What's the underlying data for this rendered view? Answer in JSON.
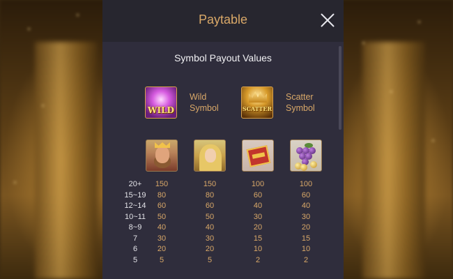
{
  "header": {
    "title": "Paytable"
  },
  "section_title": "Symbol Payout Values",
  "special_symbols": [
    {
      "icon": "wild-symbol-icon",
      "badge": "WILD",
      "name": "Wild Symbol"
    },
    {
      "icon": "scatter-symbol-icon",
      "badge": "SCATTER",
      "name": "Scatter Symbol"
    }
  ],
  "pay_symbols": [
    {
      "icon": "king-symbol-icon"
    },
    {
      "icon": "queen-symbol-icon"
    },
    {
      "icon": "treasure-chest-symbol-icon"
    },
    {
      "icon": "grapes-symbol-icon"
    }
  ],
  "paytable": {
    "rows": [
      {
        "count": "20+",
        "values": [
          "150",
          "150",
          "100",
          "100"
        ]
      },
      {
        "count": "15~19",
        "values": [
          "80",
          "80",
          "60",
          "60"
        ]
      },
      {
        "count": "12~14",
        "values": [
          "60",
          "60",
          "40",
          "40"
        ]
      },
      {
        "count": "10~11",
        "values": [
          "50",
          "50",
          "30",
          "30"
        ]
      },
      {
        "count": "8~9",
        "values": [
          "40",
          "40",
          "20",
          "20"
        ]
      },
      {
        "count": "7",
        "values": [
          "30",
          "30",
          "15",
          "15"
        ]
      },
      {
        "count": "6",
        "values": [
          "20",
          "20",
          "10",
          "10"
        ]
      },
      {
        "count": "5",
        "values": [
          "5",
          "5",
          "2",
          "2"
        ]
      }
    ]
  },
  "colors": {
    "panel_bg": "#2f2d3c",
    "header_bg": "#27262f",
    "accent_gold": "#d9a868",
    "text_light": "#f1f1f4"
  }
}
